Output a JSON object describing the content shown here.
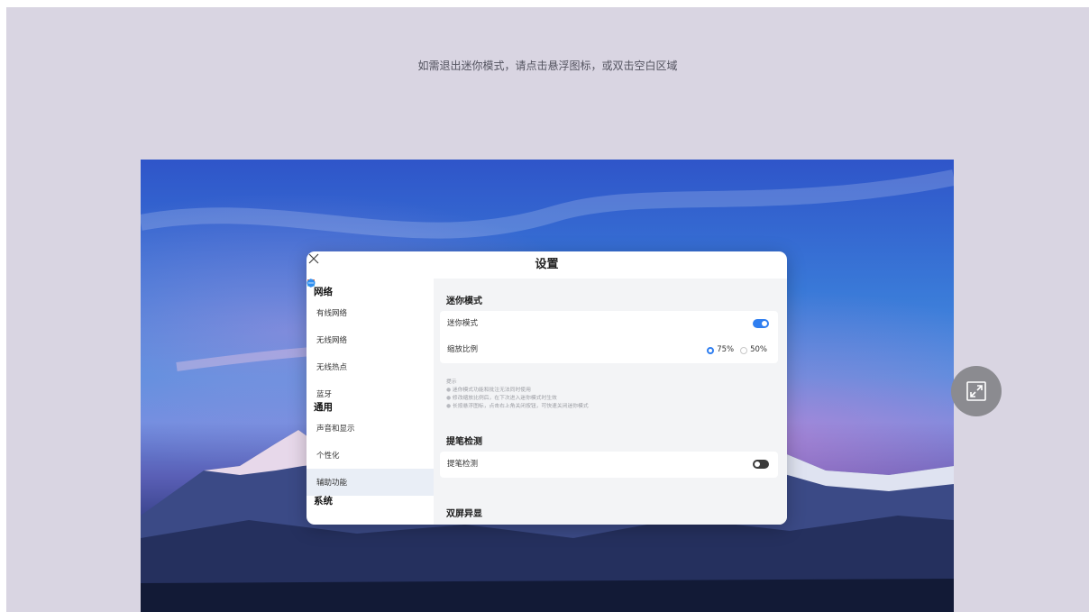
{
  "hint": "如需退出迷你模式，请点击悬浮图标，或双击空白区域",
  "dialog": {
    "title": "设置",
    "sidebar": {
      "group_network": "网络",
      "group_general": "通用",
      "group_system_partial": "系统",
      "items": [
        {
          "label": "有线网络",
          "icon": "wired-network-icon"
        },
        {
          "label": "无线网络",
          "icon": "wifi-icon"
        },
        {
          "label": "无线热点",
          "icon": "hotspot-icon"
        },
        {
          "label": "蓝牙",
          "icon": "bluetooth-icon"
        },
        {
          "label": "声音和显示",
          "icon": "sound-display-icon"
        },
        {
          "label": "个性化",
          "icon": "personalization-icon"
        },
        {
          "label": "辅助功能",
          "icon": "accessibility-icon",
          "active": true
        }
      ]
    },
    "mini_mode": {
      "section_title": "迷你模式",
      "toggle_label": "迷你模式",
      "toggle_on": true,
      "scale_label": "缩放比例",
      "scale_options": [
        "75%",
        "50%"
      ],
      "scale_selected": "75%"
    },
    "tips": {
      "title": "提示",
      "items": [
        "迷你模式功能和批注无法同时使用",
        "修改缩放比例后，在下次进入迷你模式时生效",
        "长按悬浮图标，点击右上角关闭按钮，可快速关闭迷你模式"
      ]
    },
    "pen_detection": {
      "section_title": "提笔检测",
      "toggle_label": "提笔检测",
      "toggle_on": false
    },
    "dual_screen": {
      "section_title": "双屏异显"
    }
  },
  "colors": {
    "background": "#d9d5e2",
    "accent": "#2f7ef0",
    "float_button": "#8b8b90"
  },
  "float_button": {
    "icon": "restore-icon"
  }
}
